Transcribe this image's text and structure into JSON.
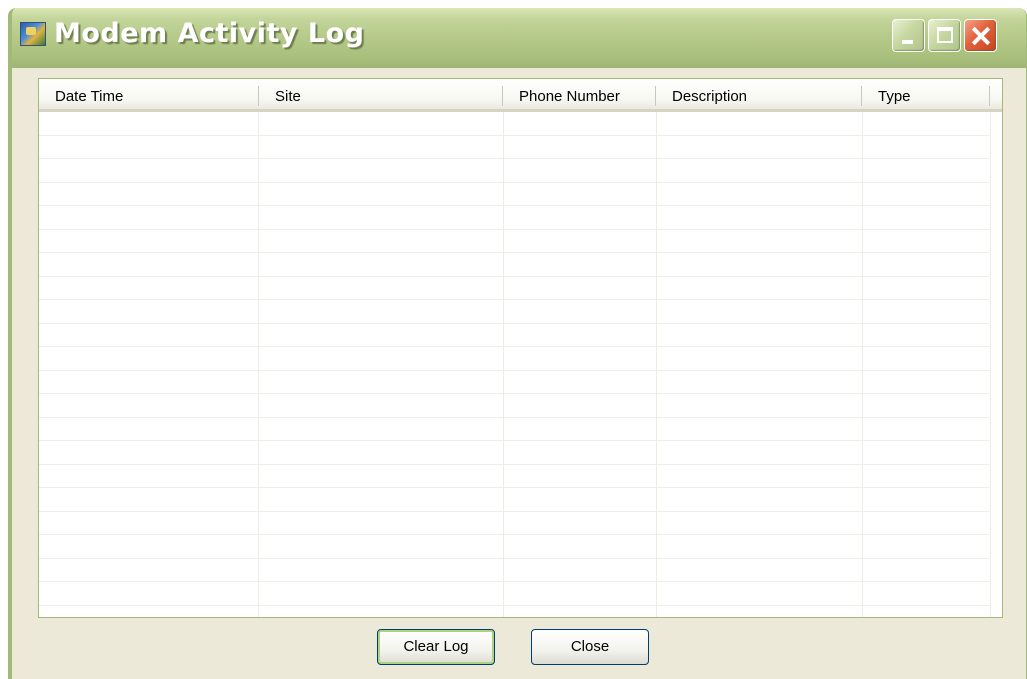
{
  "window": {
    "title": "Modem Activity Log",
    "app_icon": "modem-log-app-icon",
    "controls": [
      "minimize-icon",
      "maximize-icon",
      "close-icon"
    ]
  },
  "log_table": {
    "columns": [
      {
        "key": "date_time",
        "label": "Date Time"
      },
      {
        "key": "site",
        "label": "Site"
      },
      {
        "key": "phone_number",
        "label": "Phone Number"
      },
      {
        "key": "description",
        "label": "Description"
      },
      {
        "key": "type",
        "label": "Type"
      }
    ],
    "rows": []
  },
  "buttons": {
    "clear_log": "Clear Log",
    "close": "Close"
  },
  "colors": {
    "titlebar": "#b5c98a",
    "frame": "#a3b979",
    "window_bg": "#ece9d8",
    "close_button": "#e2613c"
  }
}
